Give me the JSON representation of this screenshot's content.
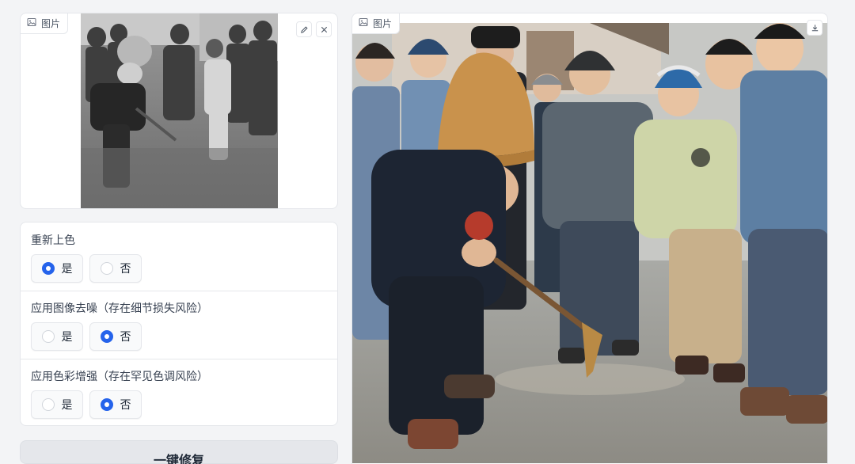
{
  "input_image": {
    "tag_label": "图片",
    "tag_icon": "image-icon",
    "tools": [
      "edit-icon",
      "close-icon"
    ]
  },
  "options": [
    {
      "label": "重新上色",
      "choices": [
        "是",
        "否"
      ],
      "selected": "是"
    },
    {
      "label": "应用图像去噪（存在细节损失风险）",
      "choices": [
        "是",
        "否"
      ],
      "selected": "否"
    },
    {
      "label": "应用色彩增强（存在罕见色调风险）",
      "choices": [
        "是",
        "否"
      ],
      "selected": "否"
    }
  ],
  "submit_label": "一键修复",
  "output_image": {
    "tag_label": "图片",
    "tag_icon": "image-icon",
    "tools": [
      "download-icon"
    ]
  },
  "colors": {
    "accent": "#2563eb",
    "panel_border": "#e5e7eb",
    "button_bg": "#e5e7eb"
  }
}
